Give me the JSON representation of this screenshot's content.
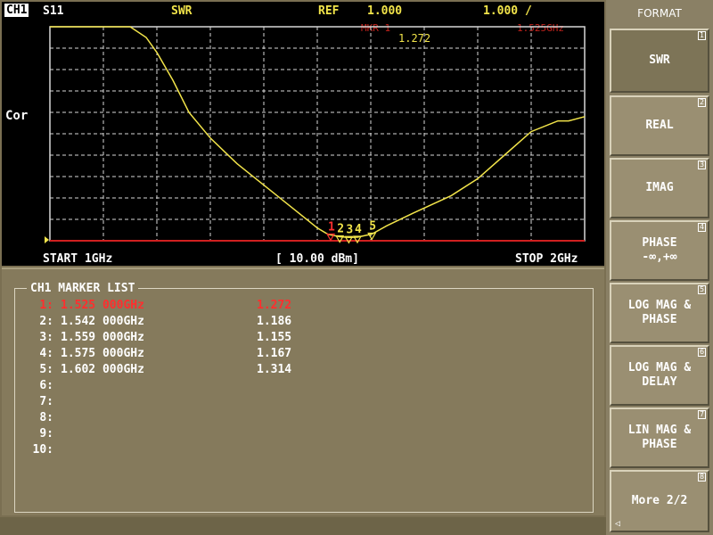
{
  "header": {
    "channel": "CH1",
    "parameter": "S11",
    "format": "SWR",
    "ref_label": "REF",
    "ref_value": "1.000",
    "scale_value": "1.000 /",
    "marker_label": "MKR 1",
    "marker_value": "1.272",
    "marker_freq": "1.525GHz",
    "correction": "Cor"
  },
  "footer": {
    "start": "START 1GHz",
    "power": "[ 10.00 dBm]",
    "stop": "STOP 2GHz"
  },
  "marker_list": {
    "title": "CH1 MARKER LIST",
    "rows": [
      {
        "index": "1:",
        "freq": "1.525 000GHz",
        "value": "1.272",
        "active": true
      },
      {
        "index": "2:",
        "freq": "1.542 000GHz",
        "value": "1.186",
        "active": false
      },
      {
        "index": "3:",
        "freq": "1.559 000GHz",
        "value": "1.155",
        "active": false
      },
      {
        "index": "4:",
        "freq": "1.575 000GHz",
        "value": "1.167",
        "active": false
      },
      {
        "index": "5:",
        "freq": "1.602 000GHz",
        "value": "1.314",
        "active": false
      },
      {
        "index": "6:",
        "freq": "",
        "value": "",
        "active": false
      },
      {
        "index": "7:",
        "freq": "",
        "value": "",
        "active": false
      },
      {
        "index": "8:",
        "freq": "",
        "value": "",
        "active": false
      },
      {
        "index": "9:",
        "freq": "",
        "value": "",
        "active": false
      },
      {
        "index": "10:",
        "freq": "",
        "value": "",
        "active": false
      }
    ]
  },
  "menu": {
    "title": "FORMAT",
    "keys": [
      {
        "label": "SWR",
        "num": "1",
        "selected": true
      },
      {
        "label": "REAL",
        "num": "2",
        "selected": false
      },
      {
        "label": "IMAG",
        "num": "3",
        "selected": false
      },
      {
        "label": "PHASE\n-∞,+∞",
        "num": "4",
        "selected": false
      },
      {
        "label": "LOG MAG &\nPHASE",
        "num": "5",
        "selected": false
      },
      {
        "label": "LOG MAG &\nDELAY",
        "num": "6",
        "selected": false
      },
      {
        "label": "LIN MAG &\nPHASE",
        "num": "7",
        "selected": false
      },
      {
        "label": "More 2/2",
        "num": "8",
        "selected": false
      }
    ],
    "more_corner_glyph": "◁"
  },
  "chart_data": {
    "type": "line",
    "xlabel": "",
    "ylabel": "",
    "xlim": [
      1.0,
      2.0
    ],
    "ylim": [
      1.0,
      11.0
    ],
    "x_unit": "GHz",
    "grid": true,
    "series": [
      {
        "color": "#f2e44a",
        "x": [
          1.0,
          1.05,
          1.1,
          1.15,
          1.18,
          1.2,
          1.23,
          1.26,
          1.3,
          1.35,
          1.4,
          1.45,
          1.5,
          1.52,
          1.542,
          1.559,
          1.575,
          1.602,
          1.63,
          1.68,
          1.75,
          1.8,
          1.85,
          1.9,
          1.95,
          1.97,
          2.0
        ],
        "y": [
          11.0,
          11.0,
          11.0,
          11.0,
          10.5,
          9.8,
          8.5,
          7.0,
          5.8,
          4.6,
          3.6,
          2.6,
          1.6,
          1.3,
          1.186,
          1.155,
          1.167,
          1.314,
          1.7,
          2.3,
          3.1,
          3.9,
          5.0,
          6.1,
          6.6,
          6.6,
          6.8
        ]
      }
    ],
    "markers": [
      {
        "label": "1",
        "x": 1.525,
        "y": 1.272,
        "active": true
      },
      {
        "label": "2",
        "x": 1.542,
        "y": 1.186,
        "active": false
      },
      {
        "label": "3",
        "x": 1.559,
        "y": 1.155,
        "active": false
      },
      {
        "label": "4",
        "x": 1.575,
        "y": 1.167,
        "active": false
      },
      {
        "label": "5",
        "x": 1.602,
        "y": 1.314,
        "active": false
      }
    ]
  }
}
